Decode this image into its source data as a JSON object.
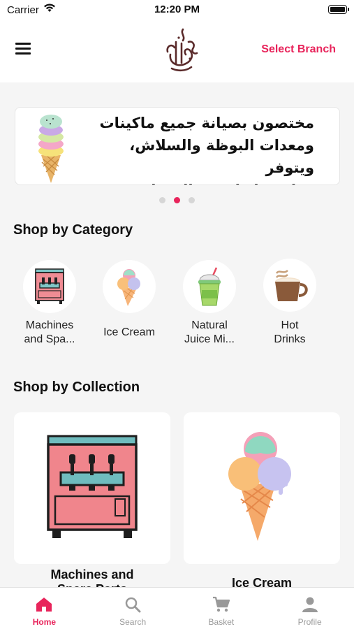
{
  "status_bar": {
    "carrier": "Carrier",
    "time": "12:20 PM"
  },
  "header": {
    "select_branch": "Select Branch"
  },
  "banner": {
    "text_line1": "مختصون بصيانة جميع ماكينات",
    "text_line2": "ومعدات البوظة والسلاش، ويتوفر",
    "text_line3": "قطع غيار لجميع المعدات",
    "active_slide": 2,
    "slide_count": 3
  },
  "categories": {
    "title": "Shop by Category",
    "items": [
      {
        "line1": "Machines",
        "line2": "and Spa...",
        "icon": "machine-icon"
      },
      {
        "line1": "Ice Cream",
        "line2": "",
        "icon": "ice-cream-icon"
      },
      {
        "line1": "Natural",
        "line2": "Juice Mi...",
        "icon": "juice-icon"
      },
      {
        "line1": "Hot",
        "line2": "Drinks",
        "icon": "coffee-icon"
      }
    ]
  },
  "collections": {
    "title": "Shop by Collection",
    "items": [
      {
        "line1": "Machines and",
        "line2": "Spare Parts",
        "icon": "machine-icon"
      },
      {
        "line1": "Ice Cream",
        "icon": "ice-cream-icon"
      }
    ]
  },
  "tabs": [
    {
      "label": "Home",
      "icon": "home-icon",
      "active": true
    },
    {
      "label": "Search",
      "icon": "search-icon",
      "active": false
    },
    {
      "label": "Basket",
      "icon": "cart-icon",
      "active": false
    },
    {
      "label": "Profile",
      "icon": "profile-icon",
      "active": false
    }
  ],
  "colors": {
    "accent": "#e8245b",
    "background": "#f5f5f5"
  }
}
